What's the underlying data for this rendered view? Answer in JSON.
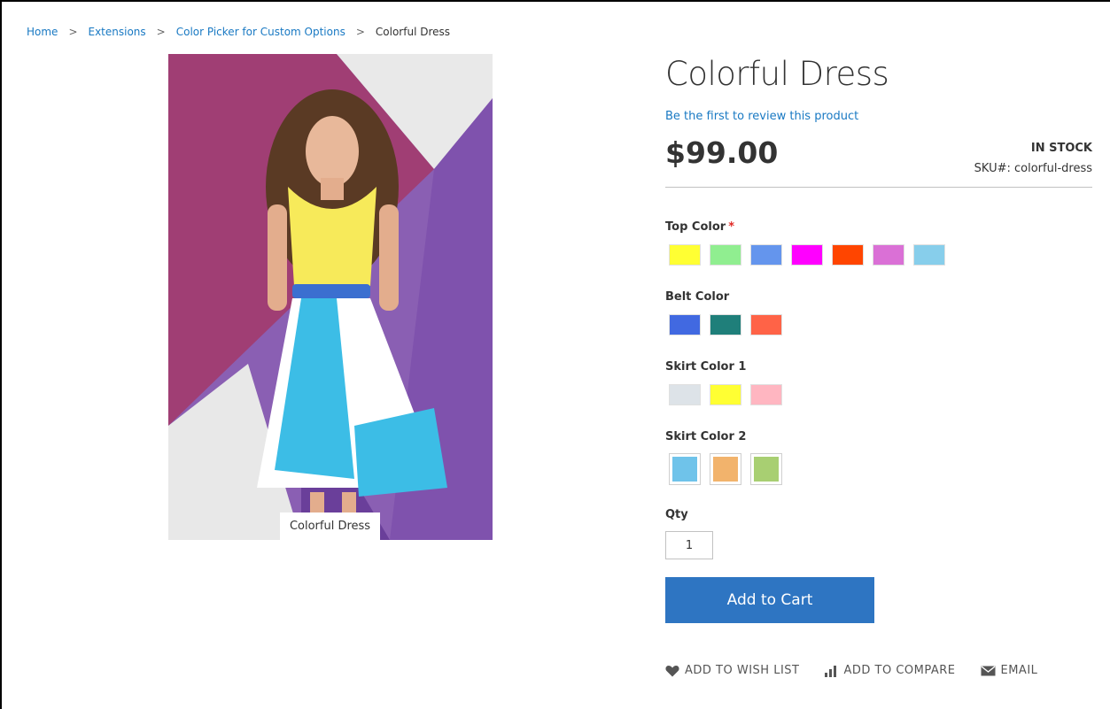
{
  "breadcrumb": {
    "items": [
      "Home",
      "Extensions",
      "Color Picker for Custom Options"
    ],
    "separator": ">",
    "current": "Colorful Dress"
  },
  "gallery": {
    "caption": "Colorful Dress"
  },
  "product": {
    "title": "Colorful Dress",
    "review_link": "Be the first to review this product",
    "price": "$99.00",
    "stock": "IN STOCK",
    "sku_label": "SKU#:",
    "sku": "colorful-dress"
  },
  "options": {
    "top_color": {
      "label": "Top Color",
      "required_mark": "*",
      "swatches": [
        "#ffff33",
        "#90ee90",
        "#6495ed",
        "#ff00ff",
        "#ff4500",
        "#da70d6",
        "#87ceeb"
      ]
    },
    "belt_color": {
      "label": "Belt Color",
      "swatches": [
        "#4169e1",
        "#1f7f7a",
        "#ff6347"
      ]
    },
    "skirt_color_1": {
      "label": "Skirt Color 1",
      "swatches": [
        "#dde3e8",
        "#ffff33",
        "#ffb6c1"
      ]
    },
    "skirt_color_2": {
      "label": "Skirt Color 2",
      "swatches": [
        "#6fc3ea",
        "#f2b36c",
        "#a8cf72"
      ]
    }
  },
  "qty": {
    "label": "Qty",
    "value": "1"
  },
  "cart": {
    "button_label": "Add to Cart"
  },
  "actions": {
    "wishlist": "ADD TO WISH LIST",
    "compare": "ADD TO COMPARE",
    "email": "EMAIL"
  },
  "colors": {
    "link": "#1979c3",
    "primary_button": "#2e75c2",
    "required": "#e02b27"
  }
}
